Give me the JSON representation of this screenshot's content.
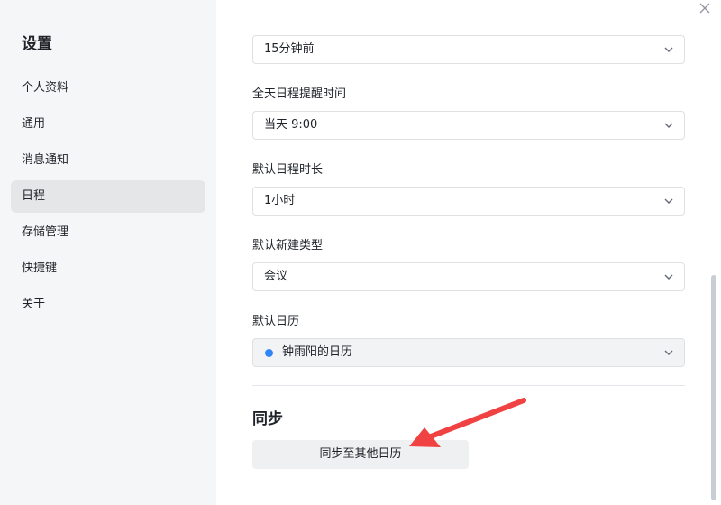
{
  "sidebar": {
    "title": "设置",
    "items": [
      {
        "label": "个人资料"
      },
      {
        "label": "通用"
      },
      {
        "label": "消息通知"
      },
      {
        "label": "日程",
        "active": true
      },
      {
        "label": "存储管理"
      },
      {
        "label": "快捷键"
      },
      {
        "label": "关于"
      }
    ]
  },
  "settings": {
    "reminder_value": "15分钟前",
    "allday_label": "全天日程提醒时间",
    "allday_value": "当天 9:00",
    "duration_label": "默认日程时长",
    "duration_value": "1小时",
    "newtype_label": "默认新建类型",
    "newtype_value": "会议",
    "calendar_label": "默认日历",
    "calendar_value": "钟雨阳的日历",
    "calendar_color": "#2f86f6"
  },
  "sync": {
    "title": "同步",
    "button_label": "同步至其他日历"
  },
  "icons": {
    "close": "close-icon",
    "dropdown": "chevron-down-icon",
    "annotation": "red-arrow-annotation"
  },
  "colors": {
    "annotation_arrow": "#f04242",
    "calendar_dot": "#2f86f6"
  }
}
